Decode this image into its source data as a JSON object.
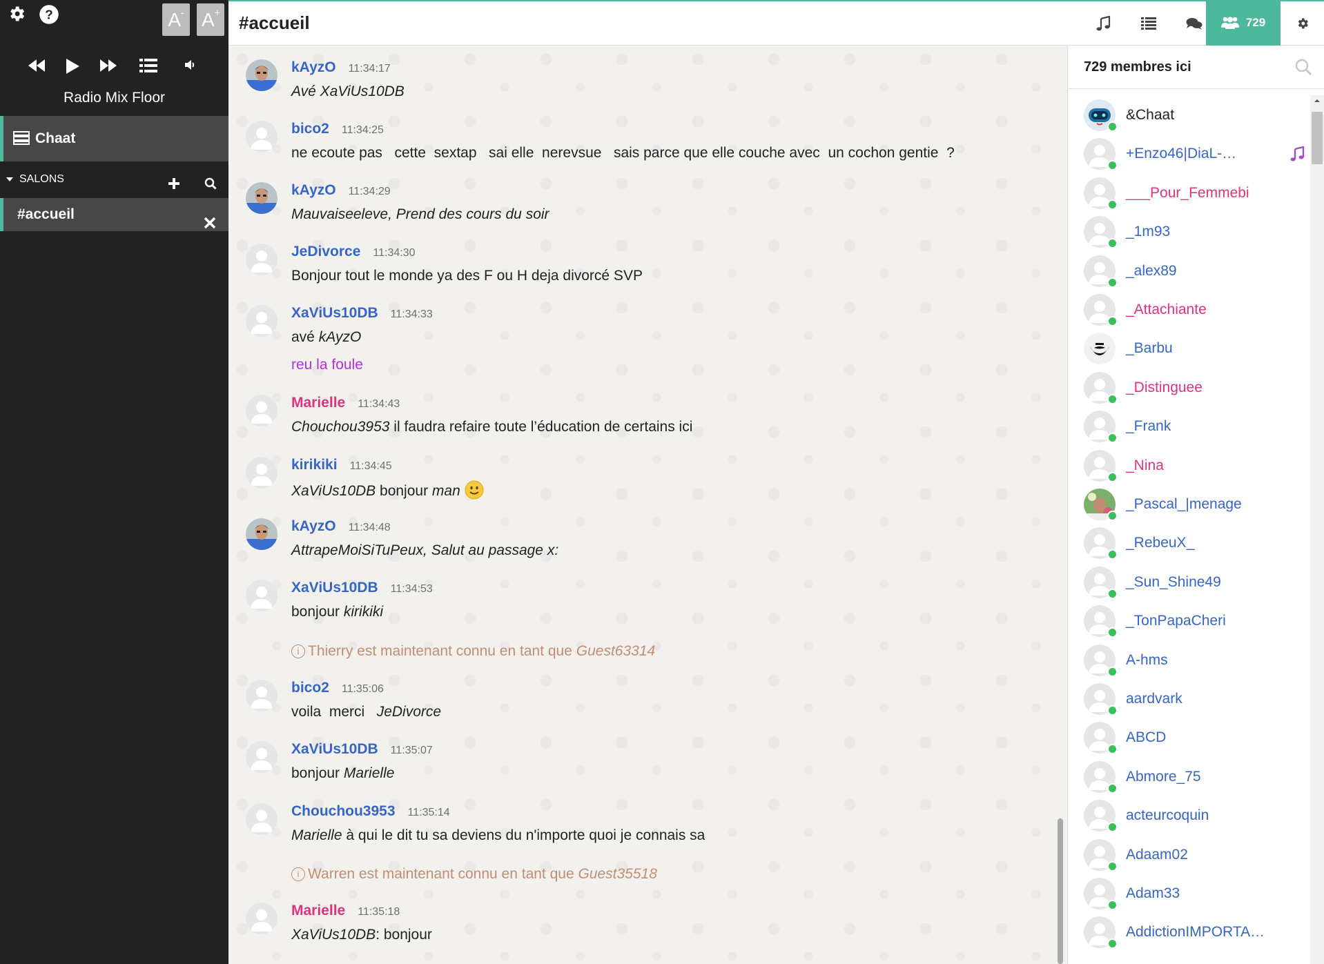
{
  "sidebar": {
    "font_decrease": "A",
    "font_decrease_sup": "-",
    "font_increase": "A",
    "font_increase_sup": "+",
    "radio_title": "Radio Mix Floor",
    "main_item": "Chaat",
    "salons_label": "SALONS",
    "room": "#accueil"
  },
  "header": {
    "channel": "#accueil",
    "members_count": "729"
  },
  "colors": {
    "accent": "#4cb89c",
    "nick_blue": "#3565c8",
    "nick_pink": "#e0327f",
    "green": "#12a01a",
    "purple": "#b62edb",
    "notice": "#c48d72"
  },
  "messages": [
    {
      "nick": "kAyzO",
      "time": "11:34:17",
      "text": "Avé XaViUs10DB"
    },
    {
      "nick": "bico2",
      "time": "11:34:25",
      "text": "ne ecoute pas   cette  sextap   sai elle  nerevsue   sais parce que elle couche avec  un cochon gentie  ?"
    },
    {
      "nick": "kAyzO",
      "time": "11:34:29",
      "text": "Mauvaiseeleve, Prend des cours du soir"
    },
    {
      "nick": "JeDivorce",
      "time": "11:34:30",
      "text": "Bonjour tout le monde ya des F ou H deja divorcé SVP"
    },
    {
      "nick": "XaViUs10DB",
      "time": "11:34:33",
      "text_a": "avé ",
      "text_b": "kAyzO",
      "text2": "reu la foule"
    },
    {
      "nick": "Marielle",
      "time": "11:34:43",
      "mention": "Chouchou3953",
      "text": " il faudra refaire toute l’éducation de certains ici"
    },
    {
      "nick": "kirikiki",
      "time": "11:34:45",
      "mention": "XaViUs10DB",
      "text_a": " bonjour ",
      "text_b": "man"
    },
    {
      "nick": "kAyzO",
      "time": "11:34:48",
      "text": "AttrapeMoiSiTuPeux, Salut au passage x:"
    },
    {
      "nick": "XaViUs10DB",
      "time": "11:34:53",
      "text_a": "bonjour ",
      "text_b": "kirikiki"
    },
    {
      "nick": "bico2",
      "time": "11:35:06",
      "text_a": "voila  merci   ",
      "text_b": "JeDivorce"
    },
    {
      "nick": "XaViUs10DB",
      "time": "11:35:07",
      "text_a": "bonjour ",
      "text_b": "Marielle"
    },
    {
      "nick": "Chouchou3953",
      "time": "11:35:14",
      "mention": "Marielle",
      "text": " à qui le dit tu sa deviens du n'importe quoi je connais sa"
    },
    {
      "nick": "Marielle",
      "time": "11:35:18",
      "mention": "XaViUs10DB",
      "text": ": bonjour"
    }
  ],
  "notices": [
    {
      "icon": "i",
      "text": "Thierry est maintenant connu en tant que ",
      "name": "Guest63314"
    },
    {
      "icon": "i",
      "text": "Warren est maintenant connu en tant que ",
      "name": "Guest35518"
    }
  ],
  "members_panel": {
    "title": "729 membres ici",
    "members": [
      "&Chaat",
      "+Enzo46|DiaL-…",
      "___Pour_Femmebi",
      "_1m93",
      "_alex89",
      "_Attachiante",
      "_Barbu",
      "_Distinguee",
      "_Frank",
      "_Nina",
      "_Pascal_|menage",
      "_RebeuX_",
      "_Sun_Shine49",
      "_TonPapaCheri",
      "A-hms",
      "aardvark",
      "ABCD",
      "Abmore_75",
      "acteurcoquin",
      "Adaam02",
      "Adam33",
      "AddictionIMPORTA…"
    ]
  }
}
